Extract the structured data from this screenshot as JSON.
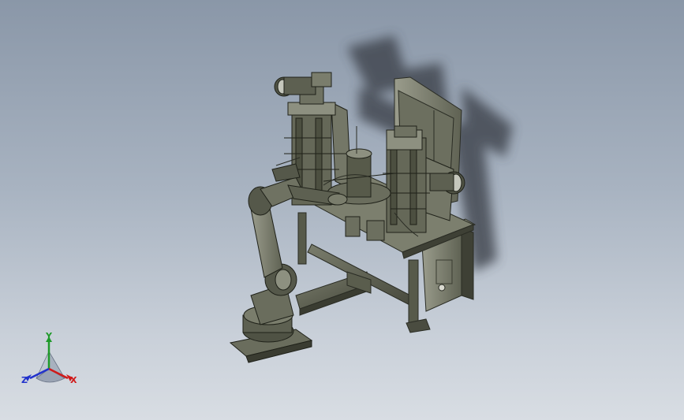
{
  "viewport": {
    "background_top": "#8a97a8",
    "background_bottom": "#d8dde3",
    "model_color": "#5b5e4e"
  },
  "triad": {
    "x_label": "X",
    "y_label": "Y",
    "z_label": "Z",
    "x_color": "#d01a1a",
    "y_color": "#1f9a2a",
    "z_color": "#2233cc"
  }
}
